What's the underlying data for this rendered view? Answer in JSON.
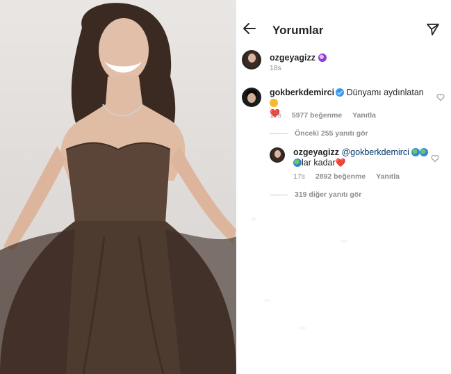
{
  "header": {
    "title": "Yorumlar",
    "back_icon": "arrow-left-icon",
    "send_icon": "paper-plane-icon"
  },
  "caption": {
    "username": "ozgeyagizz",
    "emoji": "crystal-ball",
    "time": "18s"
  },
  "comment": {
    "username": "gokberkdemirci",
    "verified": true,
    "text": "Dünyamı aydınlatan",
    "emoji_after_text": "smiling-face-with-heart-eyes",
    "heart": "❤️",
    "time": "17s",
    "likes": "5977 beğenme",
    "reply": "Yanıtla"
  },
  "view_previous": "Önceki 255 yanıtı gör",
  "reply": {
    "username": "ozgeyagizz",
    "mention": "@gokberkdemirci",
    "text_end": "lar kadar",
    "heart": "❤️",
    "time": "17s",
    "likes": "2892 beğenme",
    "reply": "Yanıtla"
  },
  "view_more": "319 diğer yanıtı gör",
  "colors": {
    "text": "#262626",
    "muted": "#8e8e8e",
    "mention": "#00376b",
    "verified": "#3897f0",
    "heart_red": "#e0245e"
  }
}
